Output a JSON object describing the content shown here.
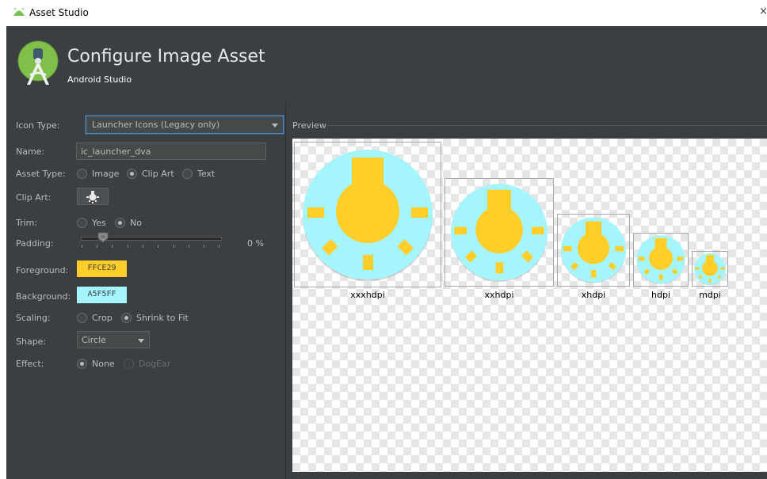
{
  "window": {
    "title": "Asset Studio",
    "close_glyph": "×"
  },
  "header": {
    "title": "Configure Image Asset",
    "subtitle": "Android Studio"
  },
  "form": {
    "icon_type": {
      "label": "Icon Type:",
      "value": "Launcher Icons (Legacy only)"
    },
    "name": {
      "label": "Name:",
      "value": "ic_launcher_dva"
    },
    "asset_type": {
      "label": "Asset Type:",
      "options": [
        "Image",
        "Clip Art",
        "Text"
      ],
      "selected": "Clip Art"
    },
    "clip_art": {
      "label": "Clip Art:",
      "icon": "lightbulb-icon"
    },
    "trim": {
      "label": "Trim:",
      "options": [
        "Yes",
        "No"
      ],
      "selected": "No"
    },
    "padding": {
      "label": "Padding:",
      "value_text": "0 %",
      "value": 0
    },
    "foreground": {
      "label": "Foreground:",
      "value": "FFCE29",
      "color": "#FFCE29"
    },
    "background": {
      "label": "Background:",
      "value": "A5F5FF",
      "color": "#A5F5FF"
    },
    "scaling": {
      "label": "Scaling:",
      "options": [
        "Crop",
        "Shrink to Fit"
      ],
      "selected": "Shrink to Fit"
    },
    "shape": {
      "label": "Shape:",
      "value": "Circle"
    },
    "effect": {
      "label": "Effect:",
      "options": [
        "None",
        "DogEar"
      ],
      "selected": "None"
    }
  },
  "preview": {
    "label": "Preview",
    "densities": [
      "xxxhdpi",
      "xxhdpi",
      "xhdpi",
      "hdpi",
      "mdpi"
    ]
  }
}
